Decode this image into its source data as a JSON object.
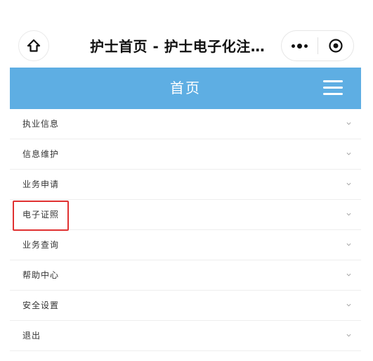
{
  "wechat_bar": {
    "title": "护士首页 - 护士电子化注…",
    "home_icon": "home-icon",
    "more_icon": "more-dots-icon",
    "close_icon": "close-miniprogram-icon"
  },
  "header": {
    "title": "首页",
    "menu_icon": "hamburger-menu-icon",
    "background": "#5eaee3"
  },
  "menu": {
    "items": [
      {
        "label": "执业信息",
        "icon": "chevron-down-icon"
      },
      {
        "label": "信息维护",
        "icon": "chevron-down-icon"
      },
      {
        "label": "业务申请",
        "icon": "chevron-down-icon"
      },
      {
        "label": "电子证照",
        "icon": "chevron-down-icon",
        "highlighted": true
      },
      {
        "label": "业务查询",
        "icon": "chevron-down-icon"
      },
      {
        "label": "帮助中心",
        "icon": "chevron-down-icon"
      },
      {
        "label": "安全设置",
        "icon": "chevron-down-icon"
      },
      {
        "label": "退出",
        "icon": "chevron-down-icon"
      }
    ]
  },
  "colors": {
    "highlight": "#e03131",
    "divider": "#eeeeee"
  }
}
